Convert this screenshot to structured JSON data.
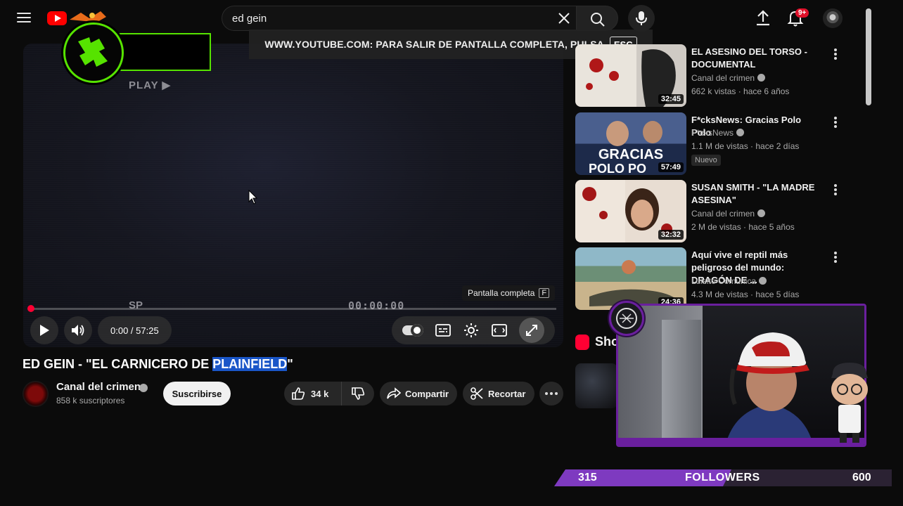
{
  "header": {
    "search_value": "ed gein",
    "notifications_badge": "9+"
  },
  "fullscreen_banner": {
    "text": "WWW.YOUTUBE.COM: PARA SALIR DE PANTALLA COMPLETA, PULSA",
    "key": "ESC"
  },
  "player": {
    "vhs_play_text": "PLAY ▶",
    "vhs_mode": "SP",
    "vhs_counter": "00:00:00",
    "tooltip_label": "Pantalla completa",
    "tooltip_key": "F",
    "time_display": "0:00 / 57:25",
    "progress_fraction": 0.0
  },
  "video": {
    "title_prefix": "ED GEIN - \"EL CARNICERO DE ",
    "title_highlight": "PLAINFIELD",
    "title_suffix": "\"",
    "channel_name": "Canal del crimen",
    "subscribers": "858 k suscriptores",
    "subscribe_label": "Suscribirse",
    "likes": "34 k",
    "share_label": "Compartir",
    "clip_label": "Recortar"
  },
  "recommendations": [
    {
      "title": "EL ASESINO DEL TORSO - DOCUMENTAL",
      "channel": "Canal del crimen",
      "meta": "662 k vistas · hace 6 años",
      "duration": "32:45",
      "badge": ""
    },
    {
      "title": "F*cksNews: Gracias Polo Polo",
      "channel": "F*cksNews",
      "meta": "1.1 M de vistas · hace 2 días",
      "duration": "57:49",
      "badge": "Nuevo"
    },
    {
      "title": "SUSAN SMITH - \"LA MADRE ASESINA\"",
      "channel": "Canal del crimen",
      "meta": "2 M de vistas · hace 5 años",
      "duration": "32:32",
      "badge": ""
    },
    {
      "title": "Aquí vive el reptil más peligroso del mundo: DRAGÓN DE ...",
      "channel": "Luisito Comunica",
      "meta": "4.3 M de vistas · hace 5 días",
      "duration": "24:36",
      "badge": ""
    }
  ],
  "shorts_label": "Sho",
  "followers": {
    "current": "315",
    "label": "FOLLOWERS",
    "goal": "600",
    "fill_fraction": 0.525
  },
  "colors": {
    "accent_red": "#ff0033",
    "overlay_green": "#56e300",
    "stream_purple": "#7e3ac0",
    "highlight_blue": "#1a56c8"
  }
}
